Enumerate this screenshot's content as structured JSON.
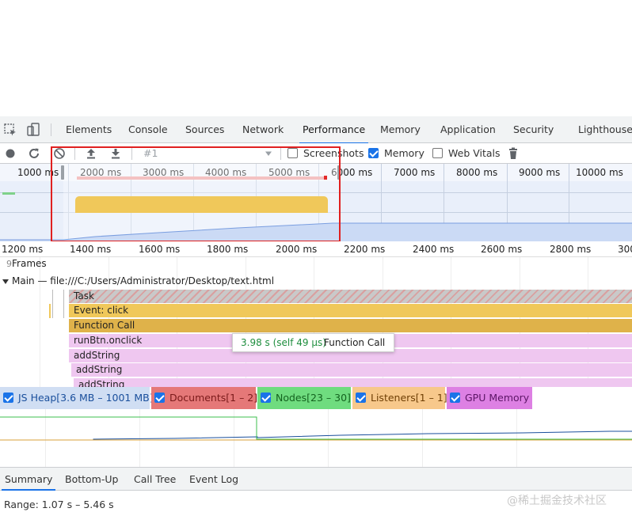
{
  "tabs": {
    "elements": "Elements",
    "console": "Console",
    "sources": "Sources",
    "network": "Network",
    "performance": "Performance",
    "memory": "Memory",
    "application": "Application",
    "security": "Security",
    "lighthouse": "Lighthouse",
    "active": "Performance"
  },
  "toolbar": {
    "profile_select": "#1",
    "screenshots_label": "Screenshots",
    "screenshots_checked": false,
    "memory_label": "Memory",
    "memory_checked": true,
    "web_vitals_label": "Web Vitals",
    "web_vitals_checked": false
  },
  "overview": {
    "ticks": [
      "1000 ms",
      "2000 ms",
      "3000 ms",
      "4000 ms",
      "5000 ms",
      "6000 ms",
      "7000 ms",
      "8000 ms",
      "9000 ms",
      "10000 ms"
    ]
  },
  "ruler": {
    "ticks": [
      "1200 ms",
      "1400 ms",
      "1600 ms",
      "1800 ms",
      "2000 ms",
      "2200 ms",
      "2400 ms",
      "2600 ms",
      "2800 ms",
      "300"
    ]
  },
  "tracks": {
    "frames": "Frames",
    "frames_value": "9",
    "main": "Main — file:///C:/Users/Administrator/Desktop/text.html"
  },
  "flame": {
    "task": "Task",
    "event_click": "Event: click",
    "function_call": "Function Call",
    "onclick": "runBtn.onclick",
    "add_string_1": "addString",
    "add_string_2": "addString",
    "add_string_3": "addString"
  },
  "tooltip": {
    "time": "3.98 s (self 49 µs)",
    "name": "Function Call"
  },
  "memory_legend": {
    "js_heap": "JS Heap[3.6 MB – 1001 MB]",
    "documents": "Documents[1 – 2]",
    "nodes": "Nodes[23 – 30]",
    "listeners": "Listeners[1 – 1]",
    "gpu_memory": "GPU Memory"
  },
  "bottom_tabs": {
    "summary": "Summary",
    "bottom_up": "Bottom-Up",
    "call_tree": "Call Tree",
    "event_log": "Event Log",
    "active": "Summary"
  },
  "summary": {
    "range": "Range: 1.07 s – 5.46 s"
  },
  "watermark": "@稀土掘金技术社区",
  "colors": {
    "accent": "#1a73e8",
    "scripting": "#f0c85a",
    "scripting_dark": "#dfb24a",
    "function_pink": "#efc7f0",
    "task_gray": "#c9c9c9",
    "selection_red": "#e32a2a",
    "js_heap_bg": "#d0def3",
    "documents_bg": "#e57878",
    "nodes_bg": "#6fdc7f",
    "listeners_bg": "#f7c88b",
    "gpu_bg": "#dd80e3"
  }
}
